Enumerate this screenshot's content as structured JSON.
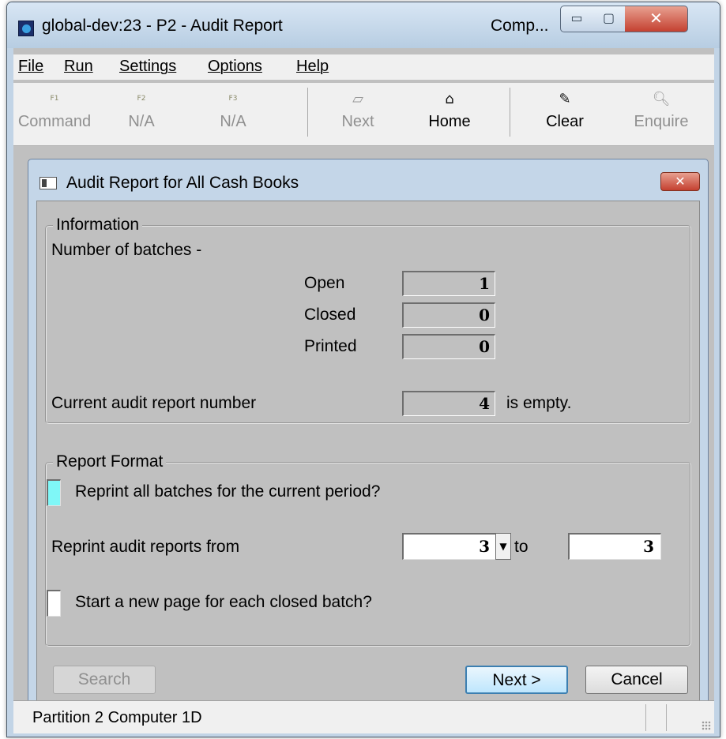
{
  "window": {
    "title": "global-dev:23 - P2 - Audit Report",
    "title_right": "Comp...",
    "controls": {
      "minimize": "▭",
      "maximize": "▢",
      "close": "✕"
    }
  },
  "menubar": {
    "items": [
      "File",
      "Run",
      "Settings",
      "Options",
      "Help"
    ]
  },
  "toolbar": {
    "buttons": [
      {
        "label": "Command",
        "icon": "f1-key-icon",
        "glyph": "F1",
        "enabled": false
      },
      {
        "label": "N/A",
        "icon": "f2-key-icon",
        "glyph": "F2",
        "enabled": false
      },
      {
        "label": "N/A",
        "icon": "f3-key-icon",
        "glyph": "F3",
        "enabled": false
      },
      {
        "label": "Next",
        "icon": "next-page-icon",
        "glyph": "▱",
        "enabled": false
      },
      {
        "label": "Home",
        "icon": "home-icon",
        "glyph": "⌂",
        "enabled": true
      },
      {
        "label": "Clear",
        "icon": "clear-icon",
        "glyph": "✎",
        "enabled": true
      },
      {
        "label": "Enquire",
        "icon": "magnifier-icon",
        "glyph": "🔍︎",
        "enabled": false
      }
    ]
  },
  "dialog": {
    "title": "Audit Report for All Cash Books",
    "close_glyph": "✕",
    "information": {
      "legend": "Information",
      "batches_label": "Number of batches -",
      "open_label": "Open",
      "open_value": "1",
      "closed_label": "Closed",
      "closed_value": "0",
      "printed_label": "Printed",
      "printed_value": "0",
      "audit_label": "Current audit report number",
      "audit_value": "4",
      "audit_suffix": "is empty."
    },
    "report_format": {
      "legend": "Report Format",
      "reprint_all_label": "Reprint all batches for the current period?",
      "reprint_all_checked": false,
      "reprint_from_label": "Reprint audit reports from",
      "reprint_from_value": "3",
      "dropdown_glyph": "▼",
      "to_label": "to",
      "reprint_to_value": "3",
      "new_page_label": "Start a new page for each closed batch?",
      "new_page_checked": false
    },
    "buttons": {
      "search": "Search",
      "next": "Next >",
      "cancel": "Cancel"
    }
  },
  "statusbar": {
    "text": "Partition 2 Computer 1D"
  },
  "colors": {
    "focused_checkbox": "#7ff7f7",
    "dialog_frame": "#c4d6e8",
    "close_red": "#c44030",
    "form_background": "#c0c0c0"
  }
}
